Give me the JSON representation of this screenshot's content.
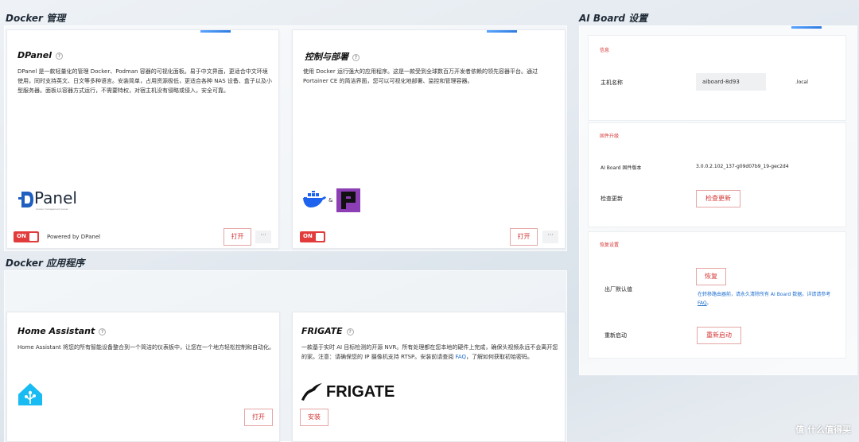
{
  "sections": {
    "docker_manage": "Docker 管理",
    "docker_apps": "Docker 应用程序",
    "ai_board_settings": "AI Board 设置"
  },
  "dpanel": {
    "title": "DPanel",
    "description": "DPanel 是一款轻量化的管理 Docker、Podman 容器的可视化面板。易于中文界面，更适合中文环境使用，同时支持英文、日文等多种语言。安装简单，占用资源极低，更适合各种 NAS 设备、盒子以及小型服务器。面板以容器方式运行，不需要特权，对宿主机没有侵略或侵入，安全可靠。",
    "logo_text": "Panel",
    "logo_sub": "docker management panel",
    "toggle": "ON",
    "powered": "Powered by DPanel",
    "open": "打开",
    "more": "···"
  },
  "deploy": {
    "title": "控制与部署",
    "description": "使用 Docker 运行强大的应用程序。这是一款受到全球数百万开发者依赖的领先容器平台。通过 Portainer CE 的简洁界面，您可以可视化地部署、监控和管理容器。",
    "amp": "&",
    "toggle": "ON",
    "open": "打开",
    "more": "···"
  },
  "home_assistant": {
    "title": "Home Assistant",
    "description": "Home Assistant 将您的所有智能设备整合到一个简洁的仪表板中，让您在一个地方轻松控制和自动化。",
    "open": "打开"
  },
  "frigate": {
    "title": "FRIGATE",
    "desc_before_link": "一款基于实时 AI 目标检测的开源 NVR。所有处理都在您本地的硬件上完成，确保头视频永远不会离开您的家。注意：请确保您的 IP 摄像机支持 RTSP。安装前请查阅 ",
    "desc_link": "FAQ",
    "desc_after_link": "，了解如何获取初始密码。",
    "logo_text": "FRIGATE",
    "install": "安装"
  },
  "settings": {
    "info_head": "信息",
    "hostname_label": "主机名称",
    "hostname_value": "aiboard-8d93",
    "hostname_suffix": ".local",
    "firmware_head": "固件升级",
    "firmware_label": "AI Board 固件版本",
    "firmware_value": "3.0.0.2.102_137-g09d07b9_19-gec2d4",
    "check_label": "检查更新",
    "check_button": "检查更新",
    "restore_head": "恢复设置",
    "factory_label": "出厂默认值",
    "restore_button": "恢复",
    "factory_desc_before": "在转移路由器前，请永久清除所有 AI Board 数据。详请请参考 ",
    "factory_desc_link": "FAQ",
    "factory_desc_after": "。",
    "reboot_label": "重新启动",
    "reboot_button": "重新启动"
  },
  "watermark": "值 什么值得买",
  "colors": {
    "accent_red": "#e23b3b",
    "link_blue": "#1e6fd0"
  }
}
